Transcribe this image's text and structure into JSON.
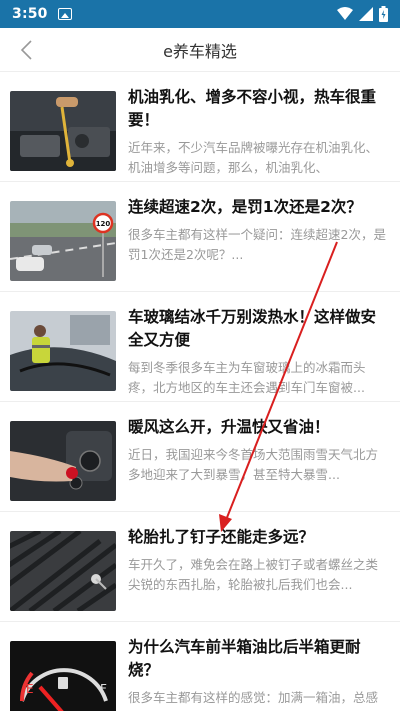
{
  "status_bar": {
    "time": "3:50"
  },
  "header": {
    "title": "e养车精选"
  },
  "articles": [
    {
      "title": "机油乳化、增多不容小视，热车很重要！",
      "desc": "近年来，不少汽车品牌被曝光存在机油乳化、机油增多等问题，那么，机油乳化、"
    },
    {
      "title": "连续超速2次，是罚1次还是2次？",
      "desc": "很多车主都有这样一个疑问：连续超速2次，是罚1次还是2次呢？..."
    },
    {
      "title": "车玻璃结冰千万别泼热水！这样做安全又方便",
      "desc": "每到冬季很多车主为车窗玻璃上的冰霜而头疼，北方地区的车主还会遇到车门车窗被..."
    },
    {
      "title": "暖风这么开，升温快又省油！",
      "desc": "近日，我国迎来今冬首场大范围雨雪天气北方多地迎来了大到暴雪，甚至特大暴雪..."
    },
    {
      "title": "轮胎扎了钉子还能走多远？",
      "desc": "车开久了，难免会在路上被钉子或者螺丝之类尖锐的东西扎胎，轮胎被扎后我们也会..."
    },
    {
      "title": "为什么汽车前半箱油比后半箱更耐烧？",
      "desc": "很多车主都有这样的感觉：加满一箱油，总感觉前半箱油好像比后半箱油更耐烧一点"
    }
  ],
  "speed_sign": {
    "value": "120"
  },
  "gauge": {
    "empty": "E",
    "full": "F"
  }
}
